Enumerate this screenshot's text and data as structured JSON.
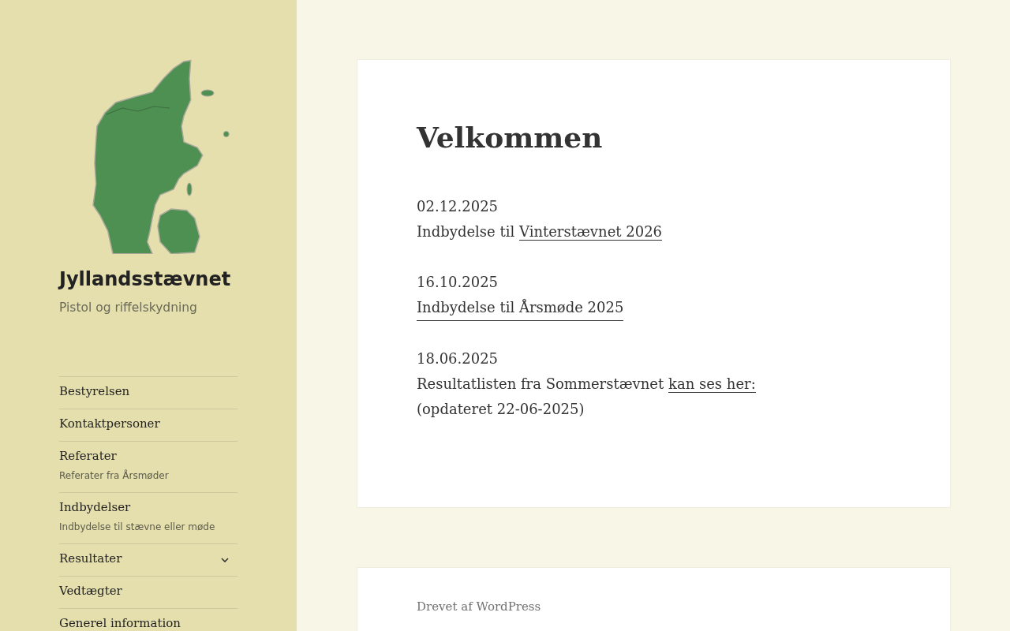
{
  "site": {
    "title": "Jyllandsstævnet",
    "tagline": "Pistol og riffelskydning"
  },
  "menu": [
    {
      "kind": "link",
      "label": "Bestyrelsen"
    },
    {
      "kind": "link",
      "label": "Kontaktpersoner"
    },
    {
      "kind": "link",
      "label": "Referater",
      "description": "Referater fra Årsmøder"
    },
    {
      "kind": "link",
      "label": "Indbydelser",
      "description": "Indbydelse til stævne eller møde"
    },
    {
      "kind": "submenu",
      "label": "Resultater",
      "expanded": false
    },
    {
      "kind": "link",
      "label": "Vedtægter"
    },
    {
      "kind": "link",
      "label": "Generel information"
    }
  ],
  "post": {
    "title": "Velkommen",
    "entries": [
      {
        "date": "02.12.2025",
        "lines": [
          [
            {
              "kind": "text",
              "text": "Indbydelse til"
            },
            {
              "kind": "link",
              "text": "Vinterstævnet 2026"
            }
          ]
        ]
      },
      {
        "date": "16.10.2025",
        "lines": [
          [
            {
              "kind": "link",
              "text": "Indbydelse til Årsmøde 2025"
            }
          ]
        ]
      },
      {
        "date": "18.06.2025",
        "lines": [
          [
            {
              "kind": "text",
              "text": "Resultatlisten fra Sommerstævnet"
            },
            {
              "kind": "link",
              "text": "kan ses her:"
            }
          ],
          [
            {
              "kind": "text",
              "text": "(opdateret 22-06-2025)"
            }
          ]
        ]
      }
    ]
  },
  "footer": {
    "credit": "Drevet af WordPress"
  }
}
